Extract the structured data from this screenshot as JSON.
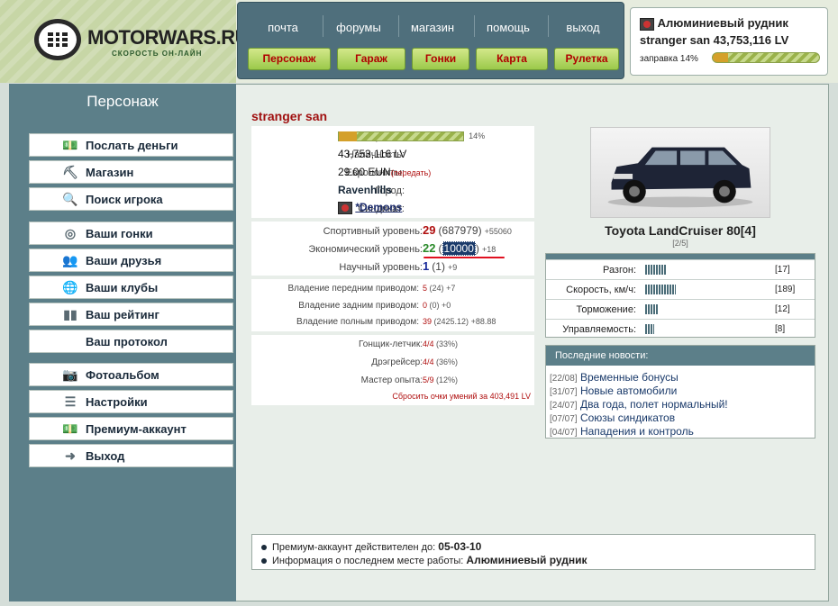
{
  "site": {
    "logo_text": "MOTORWARS.RU",
    "logo_sub": "СКОРОСТЬ ОН-ЛАЙН"
  },
  "topnav": {
    "links": [
      "почта",
      "форумы",
      "магазин",
      "помощь",
      "выход"
    ],
    "buttons": [
      "Персонаж",
      "Гараж",
      "Гонки",
      "Карта",
      "Рулетка"
    ]
  },
  "userbox": {
    "location": "Алюминиевый рудник",
    "user_line": "stranger san 43,753,116 LV",
    "fuel_label": "заправка 14%",
    "fuel_percent": 14
  },
  "sidebar": {
    "title": "Персонаж",
    "items": [
      {
        "label": "Послать деньги",
        "icon": "money-icon"
      },
      {
        "label": "Магазин",
        "icon": "shop-icon"
      },
      {
        "label": "Поиск игрока",
        "icon": "search-icon"
      },
      {
        "label": "Ваши гонки",
        "icon": "steering-wheel-icon"
      },
      {
        "label": "Ваши друзья",
        "icon": "friends-icon"
      },
      {
        "label": "Ваши клубы",
        "icon": "clubs-icon"
      },
      {
        "label": "Ваш рейтинг",
        "icon": "rating-icon"
      },
      {
        "label": "Ваш протокол",
        "icon": ""
      },
      {
        "label": "Фотоальбом",
        "icon": "camera-icon"
      },
      {
        "label": "Настройки",
        "icon": "settings-sliders-icon"
      },
      {
        "label": "Премиум-аккаунт",
        "icon": "premium-icon"
      },
      {
        "label": "Выход",
        "icon": "exit-icon"
      }
    ]
  },
  "profile": {
    "name": "stranger san",
    "fuel": {
      "label": "Заправка:",
      "percent_text": "14%",
      "percent": 14
    },
    "cash": {
      "label": "Наличность:",
      "value": "43,753,116 LV"
    },
    "euro": {
      "label": "Евро-юниты:",
      "value": "29.00 EUN",
      "action": "(передать)"
    },
    "city": {
      "label": "Город:",
      "value": "Ravenhills"
    },
    "syndicate": {
      "label": "Синдикат:",
      "value": "*Demons"
    }
  },
  "levels": {
    "sport": {
      "label": "Спортивный уровень:",
      "value": "29",
      "extra": "(687979)",
      "delta": "+55060"
    },
    "econ": {
      "label": "Экономический уровень:",
      "value": "22",
      "extra_pre": "(",
      "extra_hl": "10000",
      "extra_post": ")",
      "delta": "+18"
    },
    "science": {
      "label": "Научный уровень:",
      "value": "1",
      "extra": "(1)",
      "delta": "+9"
    }
  },
  "drive": {
    "front": {
      "label": "Владение передним приводом:",
      "value": "5",
      "extra": "(24)",
      "delta": "+7"
    },
    "rear": {
      "label": "Владение задним приводом:",
      "value": "0",
      "extra": "(0)",
      "delta": "+0"
    },
    "full": {
      "label": "Владение полным приводом:",
      "value": "39",
      "extra": "(2425.12)",
      "delta": "+88.88"
    }
  },
  "skills": {
    "pilot": {
      "label": "Гонщик-летчик:",
      "value": "4/4",
      "extra": "(33%)"
    },
    "drag": {
      "label": "Дрэгрейсер:",
      "value": "4/4",
      "extra": "(36%)"
    },
    "master": {
      "label": "Мастер опыта:",
      "value": "5/9",
      "extra": "(12%)"
    },
    "reset": "Сбросить очки умений за 403,491 LV"
  },
  "car": {
    "name": "Toyota LandCruiser 80[4]",
    "slot": "[2/5]",
    "specs": [
      {
        "label": "Разгон:",
        "value": "[17]",
        "level": 0.17
      },
      {
        "label": "Скорость, км/ч:",
        "value": "[189]",
        "level": 0.24
      },
      {
        "label": "Торможение:",
        "value": "[12]",
        "level": 0.1
      },
      {
        "label": "Управляемость:",
        "value": "[8]",
        "level": 0.07
      }
    ]
  },
  "news": {
    "title": "Последние новости:",
    "items": [
      {
        "date": "[22/08]",
        "text": "Временные бонусы"
      },
      {
        "date": "[31/07]",
        "text": "Новые автомобили"
      },
      {
        "date": "[24/07]",
        "text": "Два года, полет нормальный!"
      },
      {
        "date": "[07/07]",
        "text": "Союзы синдикатов"
      },
      {
        "date": "[04/07]",
        "text": "Нападения и контроль"
      }
    ]
  },
  "footer": {
    "premium_label": "Премиум-аккаунт действителен до:",
    "premium_value": "05-03-10",
    "work_label": "Информация о последнем месте работы:",
    "work_value": "Алюминиевый рудник"
  },
  "colors": {
    "accent_green": "#9bc94a",
    "nav_blue": "#4f6f7c",
    "red": "#b01010"
  }
}
